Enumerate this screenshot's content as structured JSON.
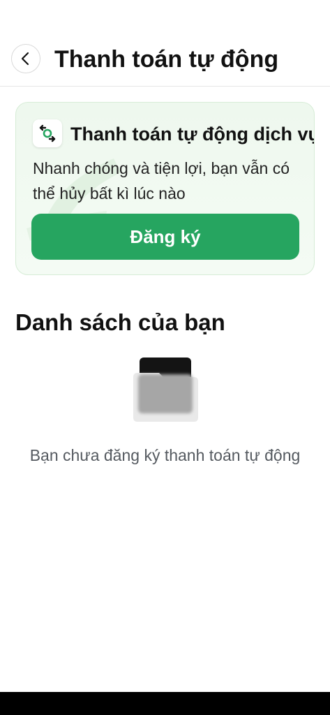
{
  "header": {
    "title": "Thanh toán tự động",
    "back_icon": "chevron-left-icon"
  },
  "promo": {
    "icon": "auto-payment-arrows-icon",
    "title": "Thanh toán tự động dịch vụ",
    "description": "Nhanh chóng và tiện lợi, bạn vẫn có thể hủy bất kì lúc nào",
    "button_label": "Đăng ký"
  },
  "list_section": {
    "title": "Danh sách của bạn",
    "empty_icon": "empty-folder-icon",
    "empty_message": "Bạn chưa đăng ký thanh toán tự động"
  },
  "colors": {
    "accent": "#26a560",
    "card_bg": "#eef8ee",
    "text_primary": "#111111",
    "text_secondary": "#555a60"
  }
}
